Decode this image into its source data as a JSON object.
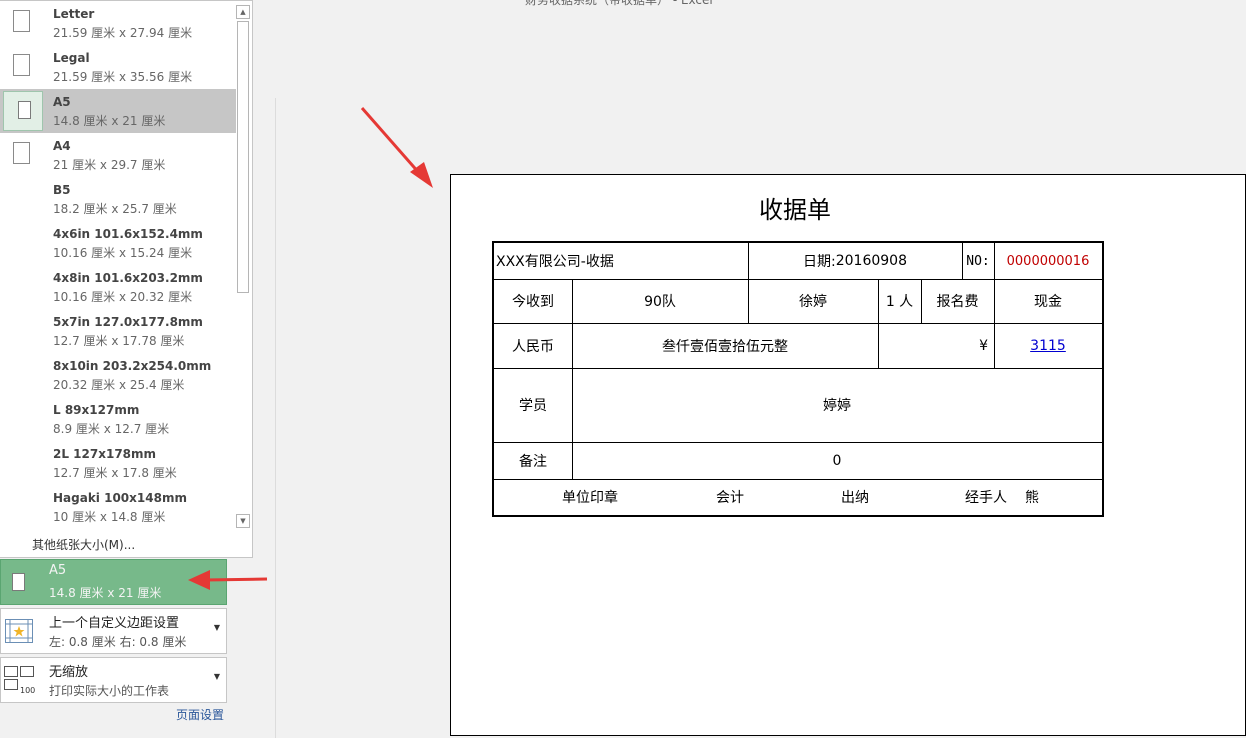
{
  "window": {
    "title": "财务收据系统（带收据单） - Excel"
  },
  "paper_sizes": {
    "items": [
      {
        "name": "Letter",
        "size": "21.59 厘米 x 27.94 厘米",
        "selected": false
      },
      {
        "name": "Legal",
        "size": "21.59 厘米 x 35.56 厘米",
        "selected": false
      },
      {
        "name": "A5",
        "size": "14.8 厘米 x 21 厘米",
        "selected": true
      },
      {
        "name": "A4",
        "size": "21 厘米 x 29.7 厘米",
        "selected": false
      },
      {
        "name": "B5",
        "size": "18.2 厘米 x 25.7 厘米",
        "selected": false
      },
      {
        "name": "4x6in 101.6x152.4mm",
        "size": "10.16 厘米 x 15.24 厘米",
        "selected": false
      },
      {
        "name": "4x8in 101.6x203.2mm",
        "size": "10.16 厘米 x 20.32 厘米",
        "selected": false
      },
      {
        "name": "5x7in 127.0x177.8mm",
        "size": "12.7 厘米 x 17.78 厘米",
        "selected": false
      },
      {
        "name": "8x10in 203.2x254.0mm",
        "size": "20.32 厘米 x 25.4 厘米",
        "selected": false
      },
      {
        "name": "L 89x127mm",
        "size": "8.9 厘米 x 12.7 厘米",
        "selected": false
      },
      {
        "name": "2L 127x178mm",
        "size": "12.7 厘米 x 17.8 厘米",
        "selected": false
      },
      {
        "name": "Hagaki 100x148mm",
        "size": "10 厘米 x 14.8 厘米",
        "selected": false
      }
    ],
    "more_label": "其他纸张大小(M)..."
  },
  "settings": {
    "paper": {
      "title": "A5",
      "sub": "14.8 厘米 x 21 厘米"
    },
    "margins": {
      "title": "上一个自定义边距设置",
      "sub": "左:  0.8 厘米     右:  0.8 厘米"
    },
    "scaling": {
      "title": "无缩放",
      "sub": "打印实际大小的工作表"
    },
    "page_setup_link": "页面设置"
  },
  "receipt": {
    "title": "收据单",
    "company": "XXX有限公司-收据",
    "date_label": "日期:",
    "date_value": "20160908",
    "no_label": "NO:",
    "no_value": "0000000016",
    "received_label": "今收到",
    "team": "90队",
    "person": "徐婷",
    "count": "1 人",
    "fee_type": "报名费",
    "payment": "现金",
    "currency_label": "人民币",
    "amount_words": "叁仟壹佰壹拾伍元整",
    "yen": "¥",
    "amount": "3115",
    "student_label": "学员",
    "student": "婷婷",
    "remark_label": "备注",
    "remark": "0",
    "footer": {
      "seal": "单位印章",
      "accountant": "会计",
      "cashier": "出纳",
      "handler": "经手人",
      "handler_name": "熊"
    }
  },
  "colors": {
    "selected_green": "#77b98a",
    "annotation_red": "#e53935",
    "amount_link": "#0000d0",
    "number_red": "#c00000"
  }
}
